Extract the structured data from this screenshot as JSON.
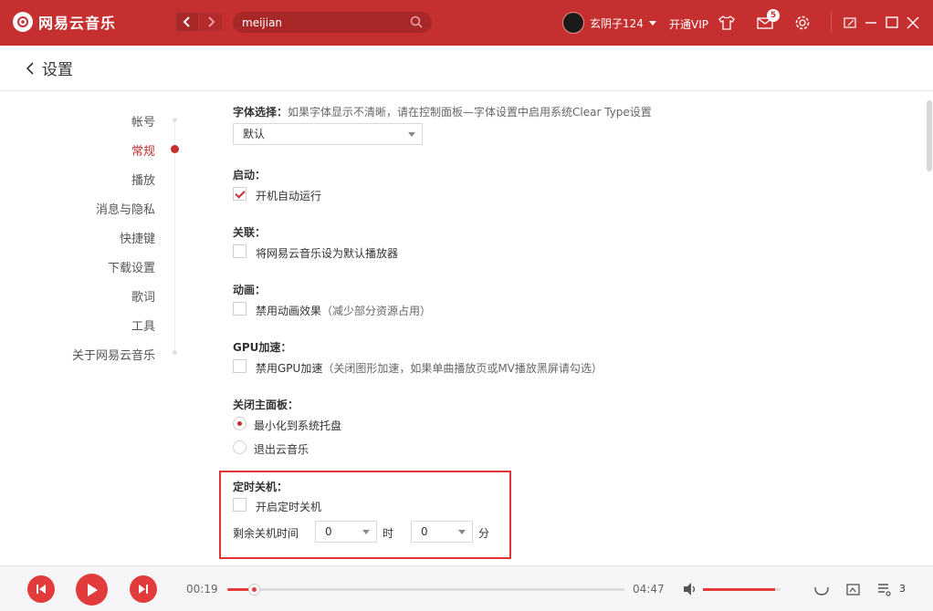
{
  "app": {
    "name": "网易云音乐"
  },
  "search": {
    "value": "meijian"
  },
  "user": {
    "name": "玄阴子124",
    "vip": "开通VIP",
    "mail_count": "5"
  },
  "page": {
    "title": "设置"
  },
  "nav": {
    "items": [
      {
        "label": "帐号",
        "active": false
      },
      {
        "label": "常规",
        "active": true
      },
      {
        "label": "播放",
        "active": false
      },
      {
        "label": "消息与隐私",
        "active": false
      },
      {
        "label": "快捷键",
        "active": false
      },
      {
        "label": "下载设置",
        "active": false
      },
      {
        "label": "歌词",
        "active": false
      },
      {
        "label": "工具",
        "active": false
      },
      {
        "label": "关于网易云音乐",
        "active": false
      }
    ]
  },
  "settings": {
    "font": {
      "title": "字体选择：",
      "desc": "如果字体显示不清晰，请在控制面板—字体设置中启用系统Clear Type设置",
      "value": "默认"
    },
    "startup": {
      "title": "启动：",
      "option": "开机自动运行",
      "checked": true
    },
    "assoc": {
      "title": "关联：",
      "option": "将网易云音乐设为默认播放器",
      "checked": false
    },
    "animation": {
      "title": "动画：",
      "option": "禁用动画效果",
      "note": "（减少部分资源占用）",
      "checked": false
    },
    "gpu": {
      "title": "GPU加速：",
      "option": "禁用GPU加速",
      "note": "（关闭图形加速，如果单曲播放页或MV播放黑屏请勾选）",
      "checked": false
    },
    "close": {
      "title": "关闭主面板：",
      "options": [
        "最小化到系统托盘",
        "退出云音乐"
      ],
      "selected": 0
    },
    "timer": {
      "title": "定时关机：",
      "option": "开启定时关机",
      "checked": false,
      "remaining_label": "剩余关机时间",
      "hours": "0",
      "hours_unit": "时",
      "minutes": "0",
      "minutes_unit": "分"
    }
  },
  "player": {
    "elapsed": "00:19",
    "total": "04:47",
    "progress": 0.066,
    "volume": 0.93,
    "playlist_count": "3"
  },
  "colors": {
    "brand": "#c62f2f",
    "accent": "#e13b3b"
  }
}
